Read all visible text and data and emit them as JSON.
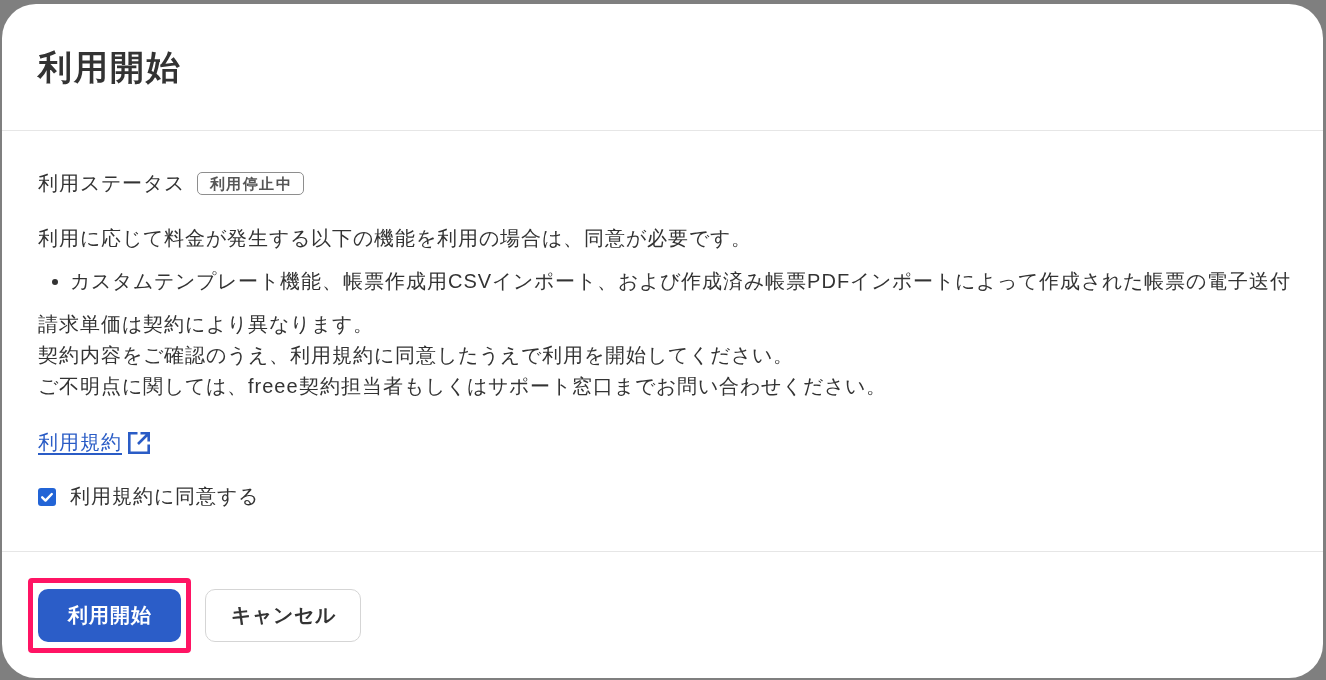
{
  "dialog": {
    "title": "利用開始"
  },
  "status": {
    "label": "利用ステータス",
    "badge": "利用停止中"
  },
  "notice": "利用に応じて料金が発生する以下の機能を利用の場合は、同意が必要です。",
  "features": [
    "カスタムテンプレート機能、帳票作成用CSVインポート、および作成済み帳票PDFインポートによって作成された帳票の電子送付"
  ],
  "notes": [
    "請求単価は契約により異なります。",
    "契約内容をご確認のうえ、利用規約に同意したうえで利用を開始してください。",
    "ご不明点に関しては、freee契約担当者もしくはサポート窓口までお問い合わせください。"
  ],
  "terms_link": {
    "label": "利用規約"
  },
  "agreement": {
    "label": "利用規約に同意する",
    "checked": true
  },
  "buttons": [
    {
      "label": "利用開始",
      "kind": "primary",
      "highlighted": true
    },
    {
      "label": "キャンセル",
      "kind": "secondary",
      "highlighted": false
    }
  ]
}
